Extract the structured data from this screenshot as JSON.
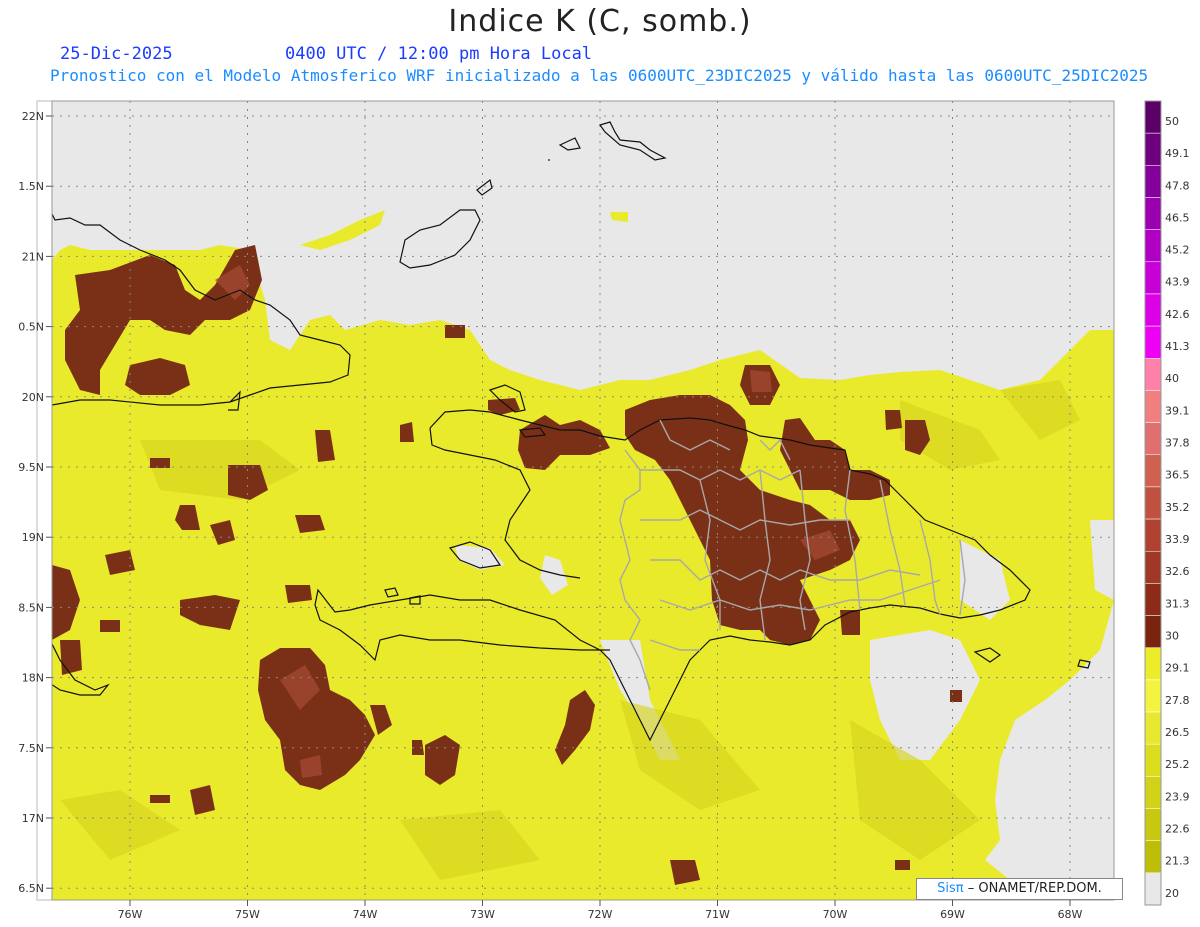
{
  "header": {
    "title": "Indice K (C, somb.)",
    "date": "25-Dic-2025",
    "time": "0400 UTC / 12:00 pm Hora Local",
    "description": "Pronostico con el Modelo Atmosferico WRF inicializado a las 0600UTC_23DIC2025 y válido hasta las  0600UTC_25DIC2025"
  },
  "map": {
    "lat_labels": [
      "22N",
      "1.5N",
      "21N",
      "0.5N",
      "20N",
      "9.5N",
      "19N",
      "8.5N",
      "18N",
      "7.5N",
      "17N",
      "6.5N"
    ],
    "lon_labels": [
      "76W",
      "75W",
      "74W",
      "73W",
      "72W",
      "71W",
      "70W",
      "69W",
      "68W"
    ],
    "colors": {
      "no_data": "#e8e8e8",
      "low": "#c8c400",
      "mid": "#e6e62a",
      "high": "#f4f43a",
      "hot": "#7a3016",
      "hot_light": "#b0503a"
    }
  },
  "legend": {
    "labels": [
      "50",
      "49.1",
      "47.8",
      "46.5",
      "45.2",
      "43.9",
      "42.6",
      "41.3",
      "40",
      "39.1",
      "37.8",
      "36.5",
      "35.2",
      "33.9",
      "32.6",
      "31.3",
      "30",
      "29.1",
      "27.8",
      "26.5",
      "25.2",
      "23.9",
      "22.6",
      "21.3",
      "20"
    ],
    "colors": [
      "#5a0066",
      "#6e0080",
      "#84009a",
      "#9a00b0",
      "#b000c4",
      "#c600d6",
      "#dc00e6",
      "#ee00f4",
      "#ff80a8",
      "#f08080",
      "#e07070",
      "#d06050",
      "#c05040",
      "#b04030",
      "#a03828",
      "#8c2c18",
      "#7a2410",
      "#ecec2a",
      "#f4f440",
      "#e8e830",
      "#dddd20",
      "#d2d218",
      "#c8c810",
      "#bebe08",
      "#b4b400"
    ]
  },
  "credit": {
    "brand": "Sisπ",
    "text": "– ONAMET/REP.DOM."
  }
}
